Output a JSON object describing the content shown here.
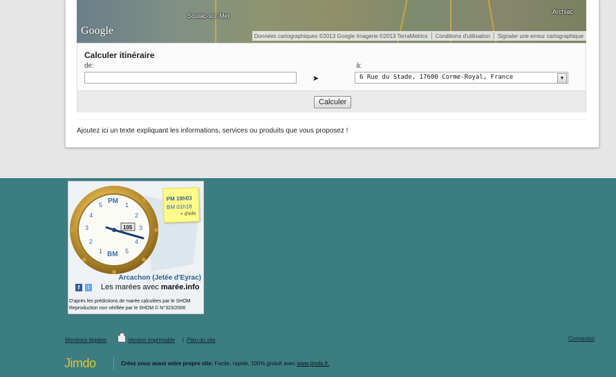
{
  "map": {
    "logo": "Google",
    "towns": [
      "Soulac-sur-Mer",
      "Archiac"
    ],
    "attribution": "Données cartographiques ©2013 Google Imagerie ©2013 TerraMetrics",
    "terms": "Conditions d'utilisation",
    "report": "Signaler une erreur cartographique"
  },
  "route": {
    "title": "Calculer itinéraire",
    "from_label": "de:",
    "from_value": "",
    "arrow": "➤",
    "to_label": "à:",
    "to_value": "6 Rue du Stade, 17600 Corme-Royal, France",
    "button": "Calculer"
  },
  "info_text": "Ajoutez ici un texte expliquant les informations, services ou produits que vous proposez !",
  "tide": {
    "note_pm": "PM 19h03",
    "note_bm": "BM 01h18",
    "note_more": "+ d'info",
    "dial_pm": "PM",
    "dial_bm": "BM",
    "coef": "105",
    "location": "Arcachon (Jetée d'Eyrac)",
    "tagline_prefix": "Les marées avec",
    "tagline_brand": "marée.info",
    "shom_line1": "D'après les prédictions de marée calculées par le SHOM",
    "shom_line2": "Reproduction non vérifiée par le SHOM © N°323/2006"
  },
  "footer": {
    "legal": "Mentions légales",
    "print": "Version imprimable",
    "sitemap": "Plan du site",
    "login": "Connexion",
    "jimdo_logo": "Jimdo",
    "jimdo_bold": "Créez vous aussi votre propre site:",
    "jimdo_text": "Facile, rapide, 100% gratuit avec",
    "jimdo_link": "www.jimdo.fr."
  }
}
